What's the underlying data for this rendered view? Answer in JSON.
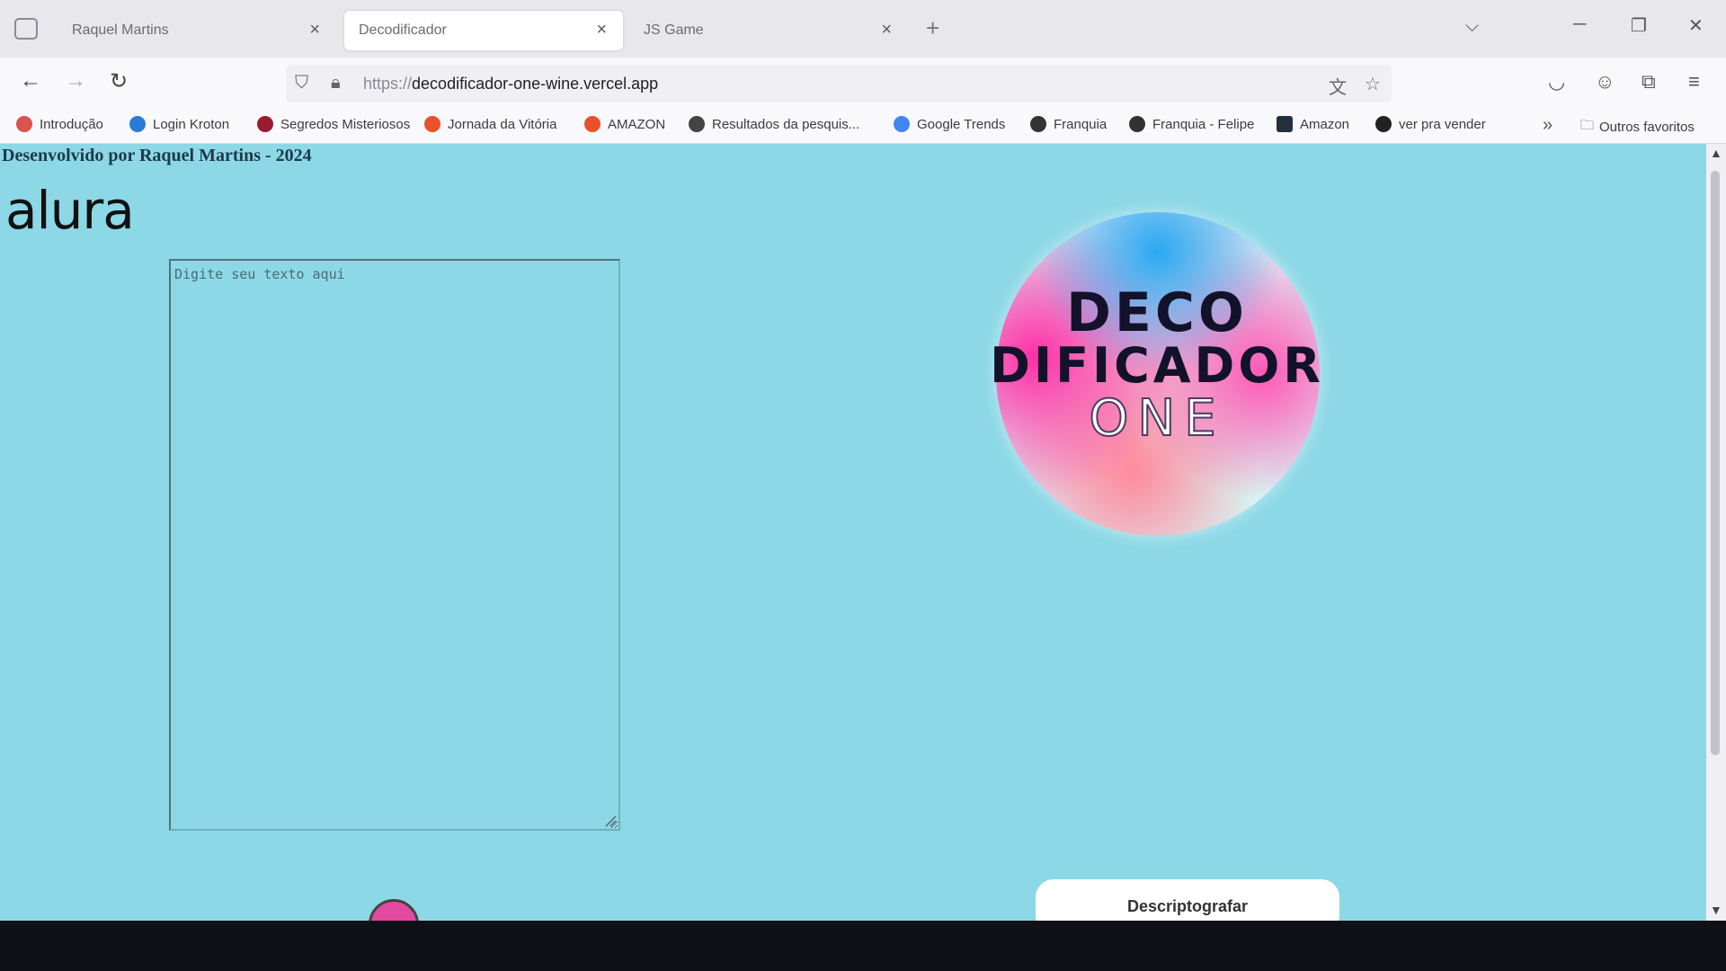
{
  "browser": {
    "tabs": [
      {
        "title": "Raquel Martins",
        "active": false
      },
      {
        "title": "Decodificador",
        "active": true
      },
      {
        "title": "JS Game",
        "active": false
      }
    ],
    "url_protocol": "https://",
    "url_host": "decodificador-one-wine.vercel.app",
    "bookmarks": [
      {
        "label": "Introdução",
        "icon_color": "#d9534f"
      },
      {
        "label": "Login Kroton",
        "icon_color": "#2b7bd9"
      },
      {
        "label": "Segredos Misteriosos",
        "icon_color": "#9b1c31"
      },
      {
        "label": "Jornada da Vitória",
        "icon_color": "#e8512a"
      },
      {
        "label": "AMAZON",
        "icon_color": "#e8512a"
      },
      {
        "label": "Resultados da pesquis...",
        "icon_color": "#444444"
      },
      {
        "label": "Google Trends",
        "icon_color": "#4285f4"
      },
      {
        "label": "Franquia",
        "icon_color": "#333333"
      },
      {
        "label": "Franquia - Felipe",
        "icon_color": "#333333"
      },
      {
        "label": "Amazon",
        "icon_color": "#232f3e"
      },
      {
        "label": "ver pra vender",
        "icon_color": "#222222"
      }
    ],
    "other_bookmarks": "Outros favoritos"
  },
  "page": {
    "credit": "Desenvolvido por Raquel Martins - 2024",
    "brand": "alura",
    "input_placeholder": "Digite seu texto aqui",
    "logo": {
      "line1": "DECO",
      "line2": "DIFICADOR",
      "line3": "ONE"
    },
    "decrypt_label": "Descriptografar",
    "background_color": "#8cd8e6"
  }
}
